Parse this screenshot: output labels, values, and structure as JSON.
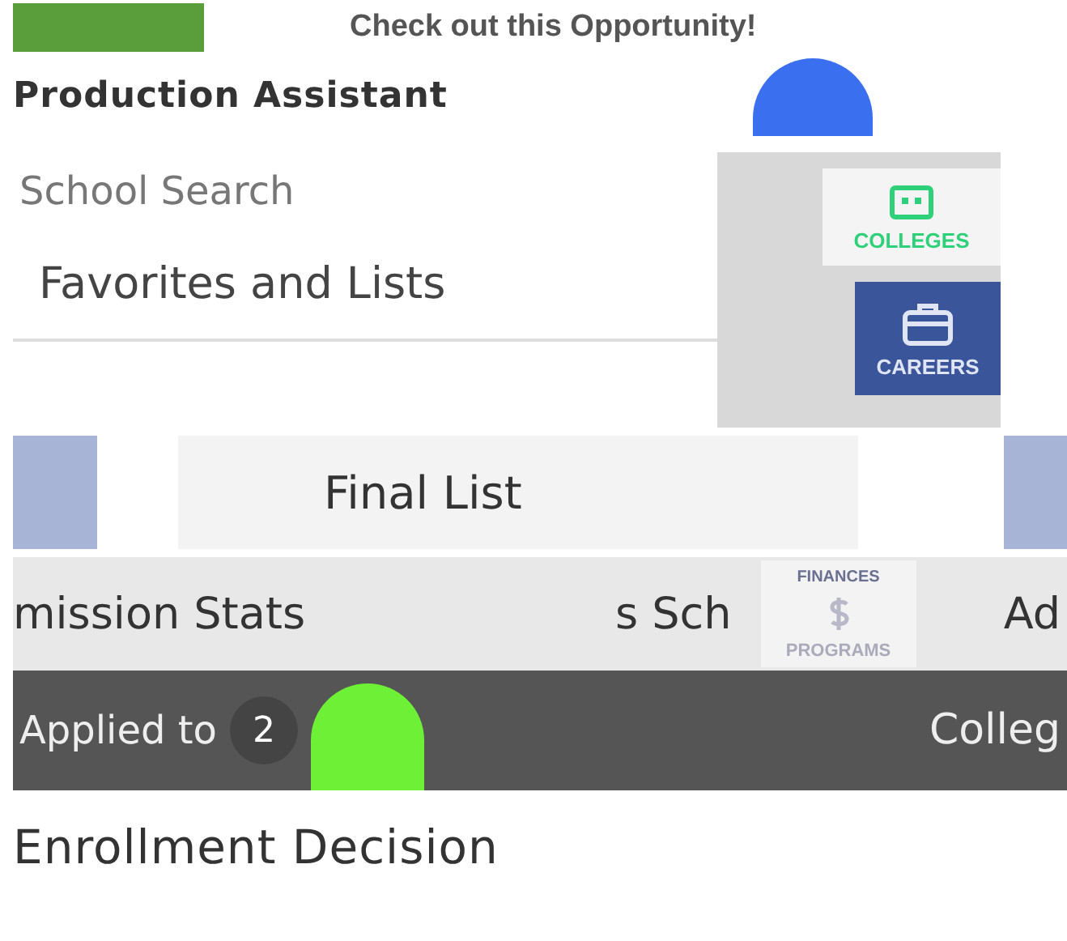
{
  "banner": {
    "title": "Check out this Opportunity!"
  },
  "job": {
    "title": "Production Assistant"
  },
  "menu": {
    "search": "School Search",
    "favorites": "Favorites and Lists",
    "final_list": "Final List",
    "admission": "mission Stats",
    "applied": {
      "label": "Applied to",
      "count": "2"
    },
    "enrollment": "Enrollment Decision"
  },
  "fragments": {
    "school": "s Sch",
    "right_top": "Ad",
    "right_bottom": "Colleg",
    "finances": "FINANCES"
  },
  "nav_tiles": [
    {
      "label": "COLLEGES",
      "kind": "colleges",
      "selected": false
    },
    {
      "label": "CAREERS",
      "kind": "careers",
      "selected": true
    },
    {
      "label": "PROGRAMS",
      "kind": "programs",
      "selected": false
    }
  ]
}
